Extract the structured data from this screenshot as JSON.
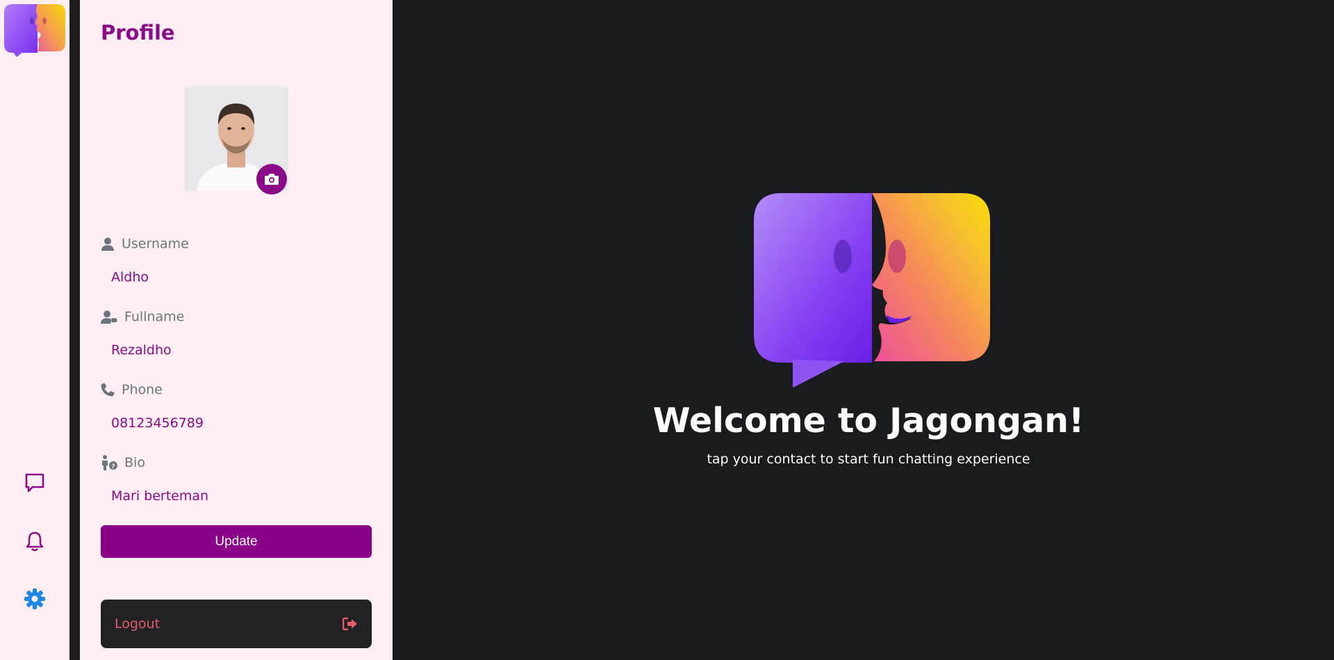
{
  "app": {
    "name": "Jagongan"
  },
  "rail": {
    "icons": [
      "chat-icon",
      "bell-icon",
      "gear-icon"
    ]
  },
  "profile": {
    "title": "Profile",
    "fields": [
      {
        "label": "Username",
        "value": "Aldho",
        "icon": "user-icon"
      },
      {
        "label": "Fullname",
        "value": "Rezaldho",
        "icon": "user-tag-icon"
      },
      {
        "label": "Phone",
        "value": "08123456789",
        "icon": "phone-icon"
      },
      {
        "label": "Bio",
        "value": "Mari berteman",
        "icon": "person-question-icon"
      }
    ],
    "update_label": "Update",
    "logout_label": "Logout"
  },
  "welcome": {
    "title": "Welcome to Jagongan!",
    "subtitle": "tap your contact to start fun chatting experience"
  },
  "colors": {
    "accent": "#8b0a87",
    "panel_bg": "#fdeef3",
    "main_bg": "#1a1b1f",
    "logout_red": "#e35d6a",
    "settings_blue": "#1e88e5"
  }
}
